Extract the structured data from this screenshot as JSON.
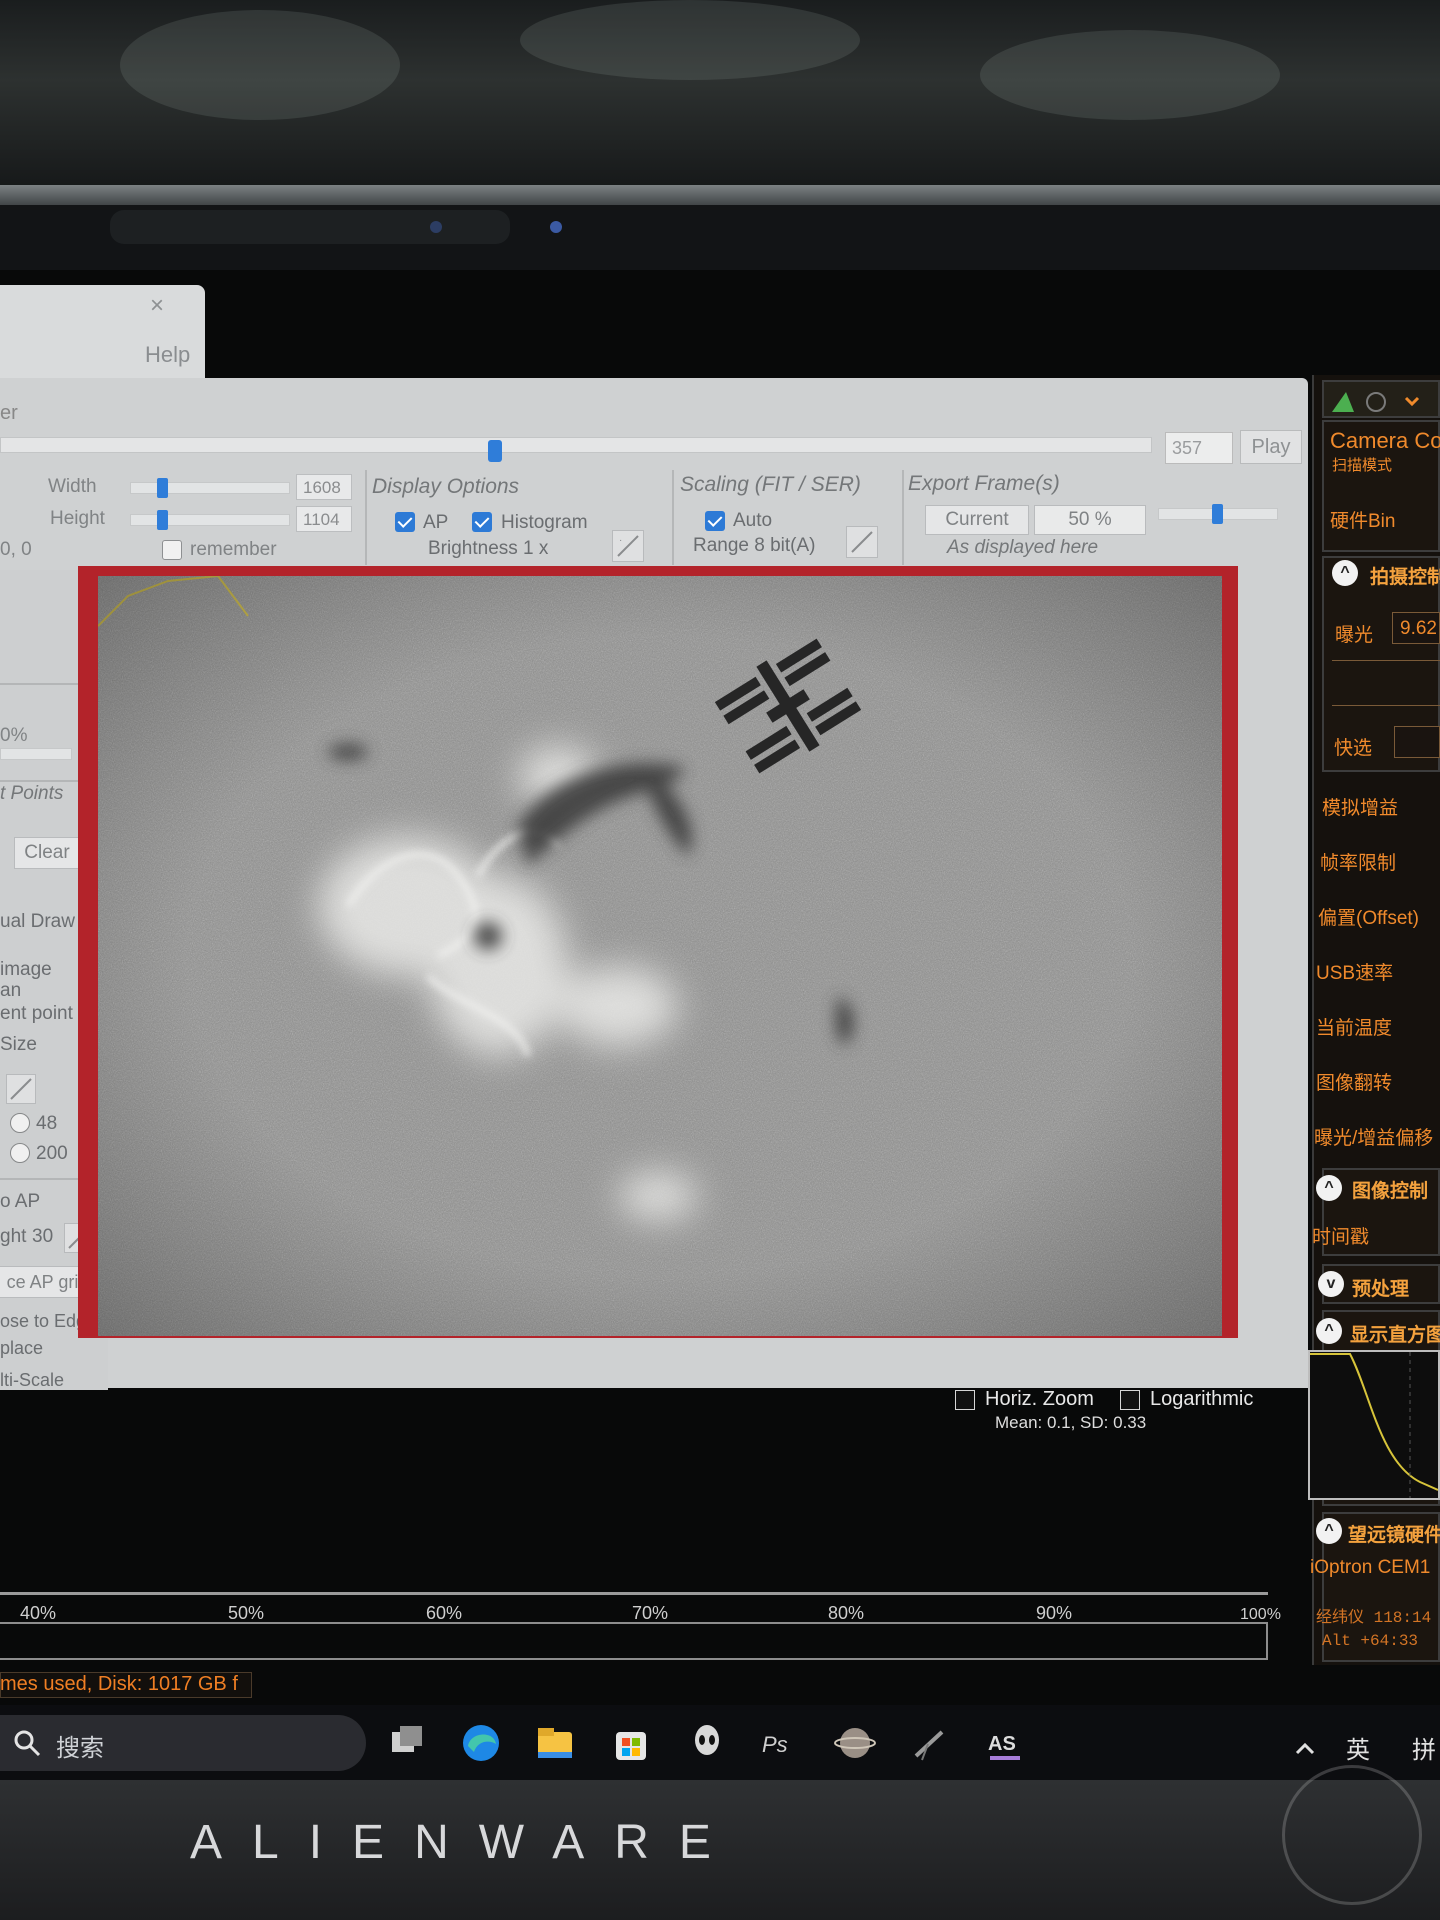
{
  "help_window": {
    "close_glyph": "×",
    "label": "Help"
  },
  "window": {
    "title_fragment": "er"
  },
  "playback": {
    "frame_count": "357",
    "play_label": "Play",
    "position_fraction": 0.43
  },
  "left_top": {
    "width_label": "Width",
    "width_value": "1608",
    "height_label": "Height",
    "height_value": "1104",
    "origin": "0, 0",
    "remember_label": "remember"
  },
  "display_options": {
    "title": "Display Options",
    "ap_label": "AP",
    "histogram_label": "Histogram",
    "brightness": "Brightness 1 x"
  },
  "scaling": {
    "title": "Scaling (FIT / SER)",
    "auto_label": "Auto",
    "range": "Range 8 bit(A)"
  },
  "export": {
    "title": "Export Frame(s)",
    "current_label": "Current",
    "percent": "50 %",
    "subtitle": "As displayed here"
  },
  "left_panel": {
    "percent_frag": "0%",
    "points_title": "t Points",
    "clear_label": "Clear",
    "manual_draw": "ual Draw",
    "image_frag": "image",
    "an_frag": "an",
    "ent_point": "ent point",
    "size_frag": "Size",
    "radio_48": "48",
    "radio_200": "200",
    "o_ap": "o AP",
    "ght_label": "ght",
    "ght_value": "30",
    "ap_grid": "ce AP grid",
    "close_edge": "ose to Edge",
    "place": "place",
    "multi_scale": "lti-Scale"
  },
  "histogram": {
    "horiz_zoom": "Horiz. Zoom",
    "logarithmic": "Logarithmic",
    "stats": "Mean: 0.1, SD: 0.33"
  },
  "right_panel": {
    "camera_title": "Camera Co",
    "scan_mode": "扫描模式",
    "hw_bin": "硬件Bin",
    "capture_ctrl": "拍摄控制",
    "exposure_label": "曝光",
    "exposure_value": "9.62",
    "quick_select": "快选",
    "items": [
      "模拟增益",
      "帧率限制",
      "偏置(Offset)",
      "USB速率",
      "当前温度",
      "图像翻转",
      "曝光/增益偏移"
    ],
    "image_ctrl": "图像控制",
    "timestamp": "时间戳",
    "preprocess": "预处理",
    "show_hist": "显示直方图",
    "telescope": "望远镜硬件",
    "mount": "iOptron CEM1",
    "gps_label": "经纬仪 118:14",
    "alt_label": "Alt  +64:33"
  },
  "scale": {
    "ticks": [
      "40%",
      "50%",
      "60%",
      "70%",
      "80%",
      "90%",
      "100%"
    ]
  },
  "status": {
    "text": "mes used, Disk: 1017 GB f"
  },
  "taskbar": {
    "search_placeholder": "搜索",
    "ime_lang": "英",
    "ime_mode": "拼"
  },
  "laptop": {
    "brand": "ALIENWARE"
  },
  "colors": {
    "accent_blue": "#2f7dd9",
    "frame_red": "#b3232a",
    "panel_orange": "#f08a2c"
  },
  "icons": [
    "close-icon",
    "search-icon",
    "task-view-icon",
    "edge-icon",
    "file-explorer-icon",
    "store-icon",
    "alienware-icon",
    "asi-icon",
    "chevron-up-icon"
  ]
}
